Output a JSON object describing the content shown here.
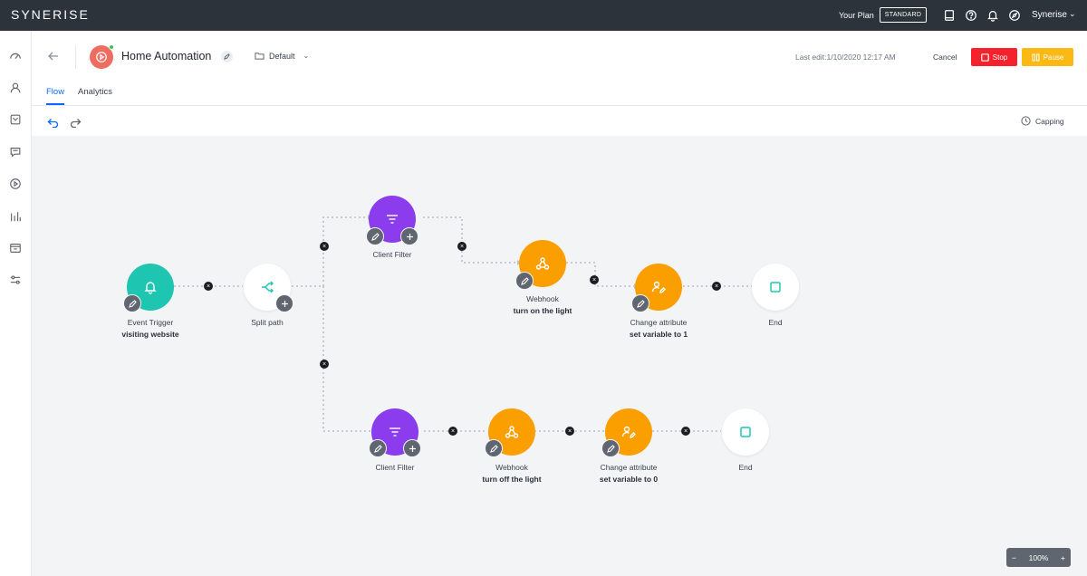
{
  "topbar": {
    "logo": "SYNERISE",
    "plan_label": "Your Plan",
    "plan_badge": "STANDARD",
    "user_name": "Synerise",
    "icons": [
      "docs-icon",
      "help-icon",
      "bell-icon",
      "compass-icon"
    ]
  },
  "sidebar": {
    "items": [
      "dashboard-icon",
      "profiles-icon",
      "catalog-icon",
      "chat-icon",
      "automation-icon",
      "analytics-icon",
      "inbox-icon",
      "settings-icon"
    ]
  },
  "header": {
    "title": "Home Automation",
    "folder": "Default",
    "last_edit": "Last edit:1/10/2020 12:17 AM",
    "cancel": "Cancel",
    "stop": "Stop",
    "pause": "Pause",
    "status_color": "#34c759"
  },
  "tabs": [
    {
      "label": "Flow",
      "active": true
    },
    {
      "label": "Analytics",
      "active": false
    }
  ],
  "toolbar": {
    "capping": "Capping"
  },
  "flow": {
    "nodes": [
      {
        "id": "trigger",
        "label": "Event Trigger",
        "sub": "visiting website",
        "color": "#1ec5b0"
      },
      {
        "id": "split",
        "label": "Split path",
        "sub": "",
        "color": "#ffffff"
      },
      {
        "id": "filter1",
        "label": "Client Filter",
        "sub": "",
        "color": "#8b3ded"
      },
      {
        "id": "webhook1",
        "label": "Webhook",
        "sub": "turn on the light",
        "color": "#fb9e00"
      },
      {
        "id": "attr1",
        "label": "Change attribute",
        "sub": "set variable to 1",
        "color": "#fb9e00"
      },
      {
        "id": "end1",
        "label": "End",
        "sub": "",
        "color": "#ffffff"
      },
      {
        "id": "filter2",
        "label": "Client Filter",
        "sub": "",
        "color": "#8b3ded"
      },
      {
        "id": "webhook2",
        "label": "Webhook",
        "sub": "turn off the light",
        "color": "#fb9e00"
      },
      {
        "id": "attr2",
        "label": "Change attribute",
        "sub": "set variable to 0",
        "color": "#fb9e00"
      },
      {
        "id": "end2",
        "label": "End",
        "sub": "",
        "color": "#ffffff"
      }
    ]
  },
  "zoom": {
    "value": "100%",
    "minus": "−",
    "plus": "+"
  }
}
